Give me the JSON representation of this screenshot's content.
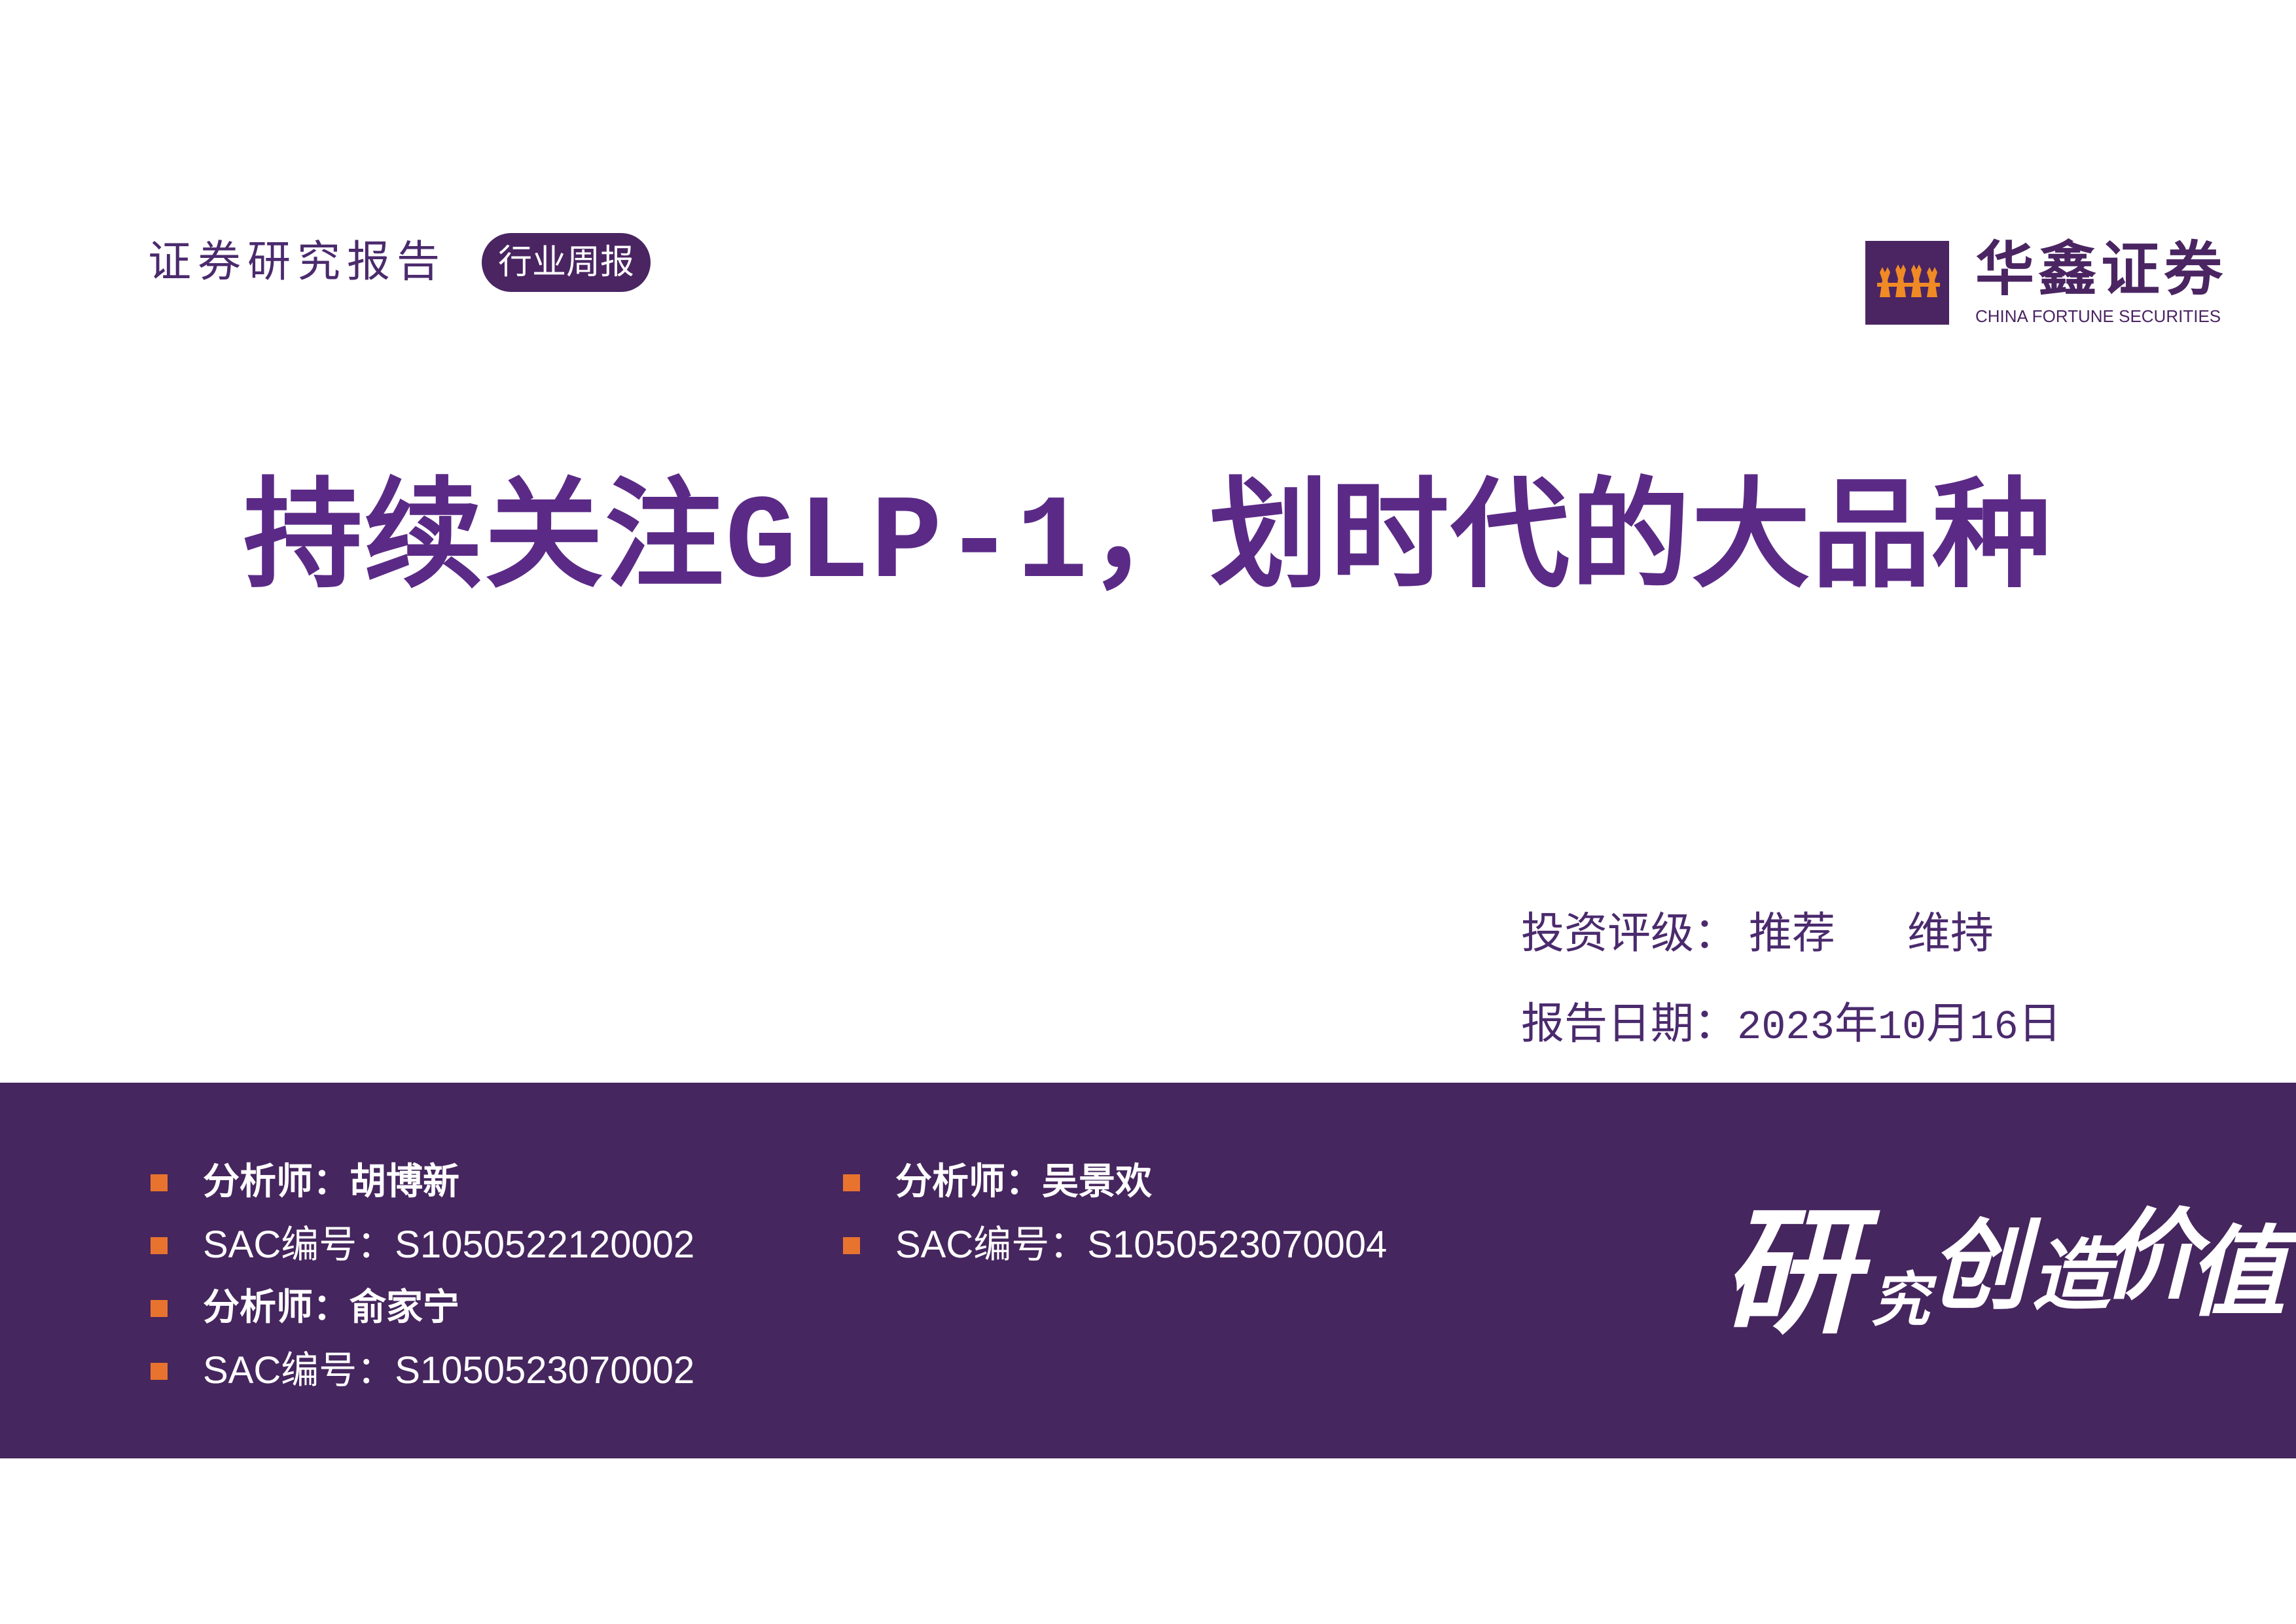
{
  "header": {
    "report_label": "证券研究报告",
    "report_type": "行业周报"
  },
  "logo": {
    "name_cn": "华鑫证券",
    "name_en": "CHINA FORTUNE SECURITIES"
  },
  "title": {
    "part1": "持续关注",
    "part2": "GLP-1",
    "part3": "，划时代的大品种"
  },
  "rating": {
    "label": "投资评级：",
    "value": "推荐",
    "change": "维持"
  },
  "date": {
    "label": "报告日期：",
    "year": "2023",
    "year_unit": "年",
    "month": "10",
    "month_unit": "月",
    "day": "16",
    "day_unit": "日"
  },
  "analysts": [
    {
      "name": "分析师：胡博新",
      "sac": "SAC编号：S1050522120002"
    },
    {
      "name": "分析师：俞家宁",
      "sac": "SAC编号：S1050523070002"
    },
    {
      "name": "分析师：吴景欢",
      "sac": "SAC编号：S1050523070004"
    }
  ],
  "slogan": {
    "c1": "研",
    "c2": "究",
    "c3": "创",
    "c4": "造",
    "c5": "价",
    "c6": "值"
  },
  "colors": {
    "brand_purple": "#4a2562",
    "title_purple": "#5b2a86",
    "band_purple": "#46265e",
    "bullet_orange": "#e8732f",
    "logo_flame": "#f08a24"
  },
  "icons": {
    "logo_mark": "flame-trident-icon",
    "bullet": "orange-square-bullet-icon"
  }
}
